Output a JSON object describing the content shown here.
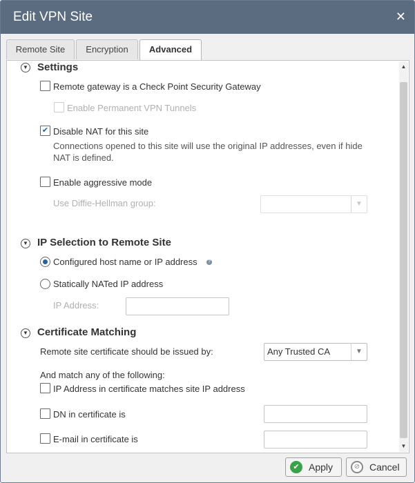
{
  "window": {
    "title": "Edit VPN Site"
  },
  "tabs": [
    {
      "label": "Remote Site",
      "active": false
    },
    {
      "label": "Encryption",
      "active": false
    },
    {
      "label": "Advanced",
      "active": true
    }
  ],
  "settings": {
    "title": "Settings",
    "remote_gateway_label": "Remote gateway is a Check Point Security Gateway",
    "remote_gateway_checked": false,
    "permanent_tunnels_label": "Enable Permanent VPN Tunnels",
    "permanent_tunnels_enabled": false,
    "disable_nat_label": "Disable NAT for this site",
    "disable_nat_checked": true,
    "disable_nat_desc_line1": "Connections opened to this site will use the original IP addresses, even if hide",
    "disable_nat_desc_line2": "NAT is defined.",
    "aggressive_mode_label": "Enable aggressive mode",
    "aggressive_mode_checked": false,
    "dh_group_label": "Use Diffie-Hellman group:",
    "dh_group_value": ""
  },
  "ip_selection": {
    "title": "IP Selection to Remote Site",
    "option_configured_label": "Configured host name or IP address",
    "option_static_label": "Statically NATed IP address",
    "selected": "configured",
    "ip_address_label": "IP Address:",
    "ip_address_value": ""
  },
  "certificate": {
    "title": "Certificate Matching",
    "issued_by_label": "Remote site certificate should be issued by:",
    "issued_by_value": "Any Trusted CA",
    "match_any_label": "And match any of the following:",
    "ip_match_label": "IP Address in certificate matches site IP address",
    "dn_label": "DN in certificate is",
    "dn_value": "",
    "email_label": "E-mail in certificate is",
    "email_value": ""
  },
  "footer": {
    "apply_label": "Apply",
    "cancel_label": "Cancel"
  },
  "colors": {
    "titlebar": "#5b6b80",
    "apply_icon": "#3aa34a",
    "cancel_icon": "#888888",
    "check": "#1b5eae"
  }
}
